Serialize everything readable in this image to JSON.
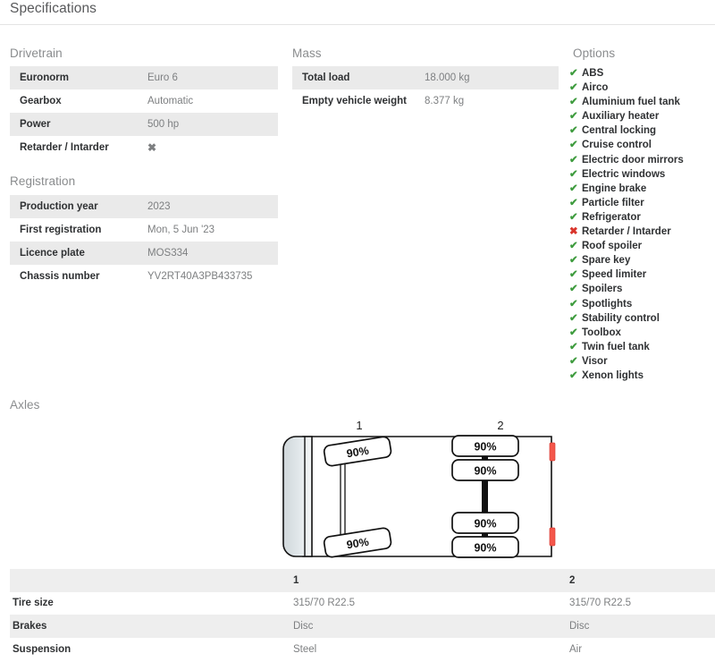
{
  "page": {
    "title": "Specifications"
  },
  "sections": {
    "drivetrain": {
      "heading": "Drivetrain",
      "rows": [
        {
          "label": "Euronorm",
          "value": "Euro 6",
          "type": "text"
        },
        {
          "label": "Gearbox",
          "value": "Automatic",
          "type": "text"
        },
        {
          "label": "Power",
          "value": "500 hp",
          "type": "text"
        },
        {
          "label": "Retarder / Intarder",
          "value": "✖",
          "type": "mark-no"
        }
      ]
    },
    "registration": {
      "heading": "Registration",
      "rows": [
        {
          "label": "Production year",
          "value": "2023",
          "type": "text"
        },
        {
          "label": "First registration",
          "value": "Mon, 5 Jun '23",
          "type": "text"
        },
        {
          "label": "Licence plate",
          "value": "MOS334",
          "type": "text"
        },
        {
          "label": "Chassis number",
          "value": "YV2RT40A3PB433735",
          "type": "text"
        }
      ]
    },
    "mass": {
      "heading": "Mass",
      "rows": [
        {
          "label": "Total load",
          "value": "18.000 kg",
          "type": "text"
        },
        {
          "label": "Empty vehicle weight",
          "value": "8.377 kg",
          "type": "text"
        }
      ]
    },
    "options": {
      "heading": "Options",
      "items": [
        {
          "label": "ABS",
          "included": true
        },
        {
          "label": "Airco",
          "included": true
        },
        {
          "label": "Aluminium fuel tank",
          "included": true
        },
        {
          "label": "Auxiliary heater",
          "included": true
        },
        {
          "label": "Central locking",
          "included": true
        },
        {
          "label": "Cruise control",
          "included": true
        },
        {
          "label": "Electric door mirrors",
          "included": true
        },
        {
          "label": "Electric windows",
          "included": true
        },
        {
          "label": "Engine brake",
          "included": true
        },
        {
          "label": "Particle filter",
          "included": true
        },
        {
          "label": "Refrigerator",
          "included": true
        },
        {
          "label": "Retarder / Intarder",
          "included": false
        },
        {
          "label": "Roof spoiler",
          "included": true
        },
        {
          "label": "Spare key",
          "included": true
        },
        {
          "label": "Speed limiter",
          "included": true
        },
        {
          "label": "Spoilers",
          "included": true
        },
        {
          "label": "Spotlights",
          "included": true
        },
        {
          "label": "Stability control",
          "included": true
        },
        {
          "label": "Toolbox",
          "included": true
        },
        {
          "label": "Twin fuel tank",
          "included": true
        },
        {
          "label": "Visor",
          "included": true
        },
        {
          "label": "Xenon lights",
          "included": true
        }
      ],
      "yes_glyph": "✔",
      "no_glyph": "✖"
    },
    "axles": {
      "heading": "Axles",
      "diagram": {
        "axle_labels": [
          "1",
          "2"
        ],
        "tire_wear_labels": [
          "90%",
          "90%",
          "90%",
          "90%",
          "90%",
          "90%"
        ],
        "front_axle_tires": [
          "90%",
          "90%"
        ],
        "rear_axle_tires": [
          "90%",
          "90%",
          "90%",
          "90%"
        ]
      },
      "table": {
        "column_headers": [
          "",
          "1",
          "2"
        ],
        "rows": [
          {
            "label": "Tire size",
            "values": [
              "315/70 R22.5",
              "315/70 R22.5"
            ]
          },
          {
            "label": "Brakes",
            "values": [
              "Disc",
              "Disc"
            ]
          },
          {
            "label": "Suspension",
            "values": [
              "Steel",
              "Air"
            ]
          }
        ]
      }
    }
  },
  "colors": {
    "accent_green": "#3f9c3f",
    "accent_red": "#d9342b",
    "row_stripe": "#eaeaea",
    "heading_gray": "#8a8c8e",
    "value_gray": "#7d7f81",
    "label_dark": "#2f3133",
    "diagram_marker_red": "#f4564a"
  }
}
